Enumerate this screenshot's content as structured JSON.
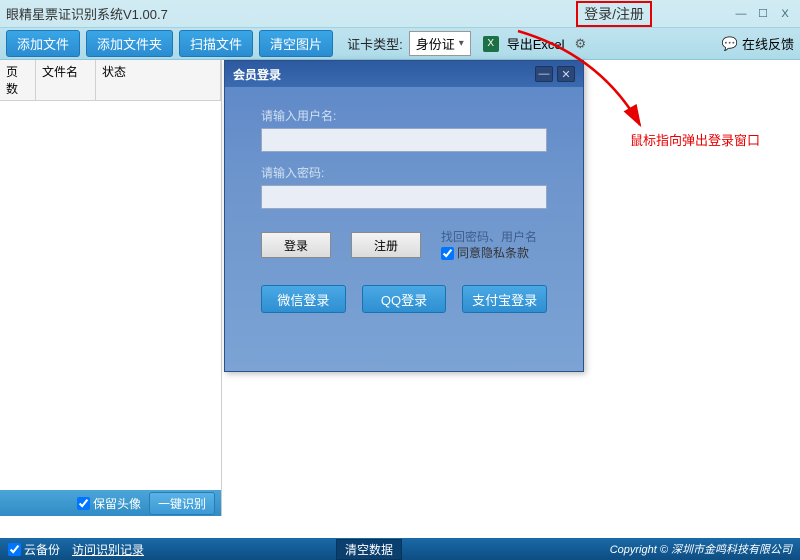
{
  "titlebar": {
    "title": "眼精星票证识别系统V1.00.7",
    "login_register": "登录/注册"
  },
  "toolbar": {
    "add_file": "添加文件",
    "add_folder": "添加文件夹",
    "scan_file": "扫描文件",
    "clear_images": "清空图片",
    "card_type_label": "证卡类型:",
    "card_type_value": "身份证",
    "export_excel": "导出Excel",
    "online_feedback": "在线反馈",
    "excel_icon_text": "X"
  },
  "columns": {
    "c1": "页数",
    "c2": "文件名",
    "c3": "状态"
  },
  "sidebar_foot": {
    "keep_avatar": "保留头像",
    "one_click": "一键识别"
  },
  "status": {
    "cloud_backup": "云备份",
    "history": "访问识别记录",
    "clear_data": "清空数据",
    "copyright": "Copyright © 深圳市金鸣科技有限公司"
  },
  "dialog": {
    "title": "会员登录",
    "username_label": "请输入用户名:",
    "password_label": "请输入密码:",
    "login": "登录",
    "register": "注册",
    "find_pw": "找回密码、用户名",
    "agree": "同意隐私条款",
    "wechat": "微信登录",
    "qq": "QQ登录",
    "alipay": "支付宝登录"
  },
  "annotation": "鼠标指向弹出登录窗口"
}
